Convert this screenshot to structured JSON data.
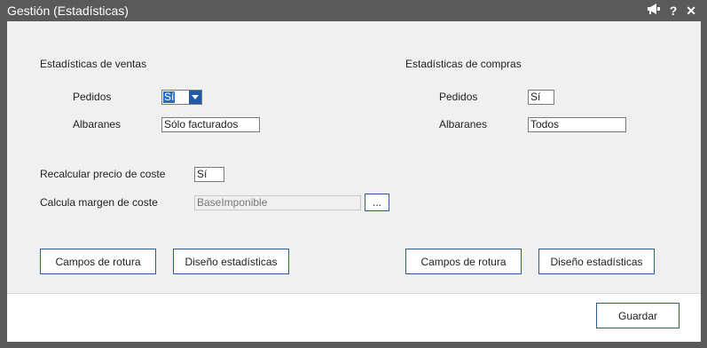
{
  "window": {
    "title": "Gestión (Estadísticas)"
  },
  "title_icons": [
    "megaphone-icon",
    "help-icon",
    "close-icon"
  ],
  "title_glyphs": {
    "help": "?",
    "close": "✕"
  },
  "sales": {
    "heading": "Estadísticas de ventas",
    "pedidos_label": "Pedidos",
    "pedidos_value": "Sí",
    "albaranes_label": "Albaranes",
    "albaranes_value": "Sólo facturados"
  },
  "purchases": {
    "heading": "Estadísticas de compras",
    "pedidos_label": "Pedidos",
    "pedidos_value": "Sí",
    "albaranes_label": "Albaranes",
    "albaranes_value": "Todos"
  },
  "cost": {
    "recalc_label": "Recalcular precio de coste",
    "recalc_value": "Sí",
    "margin_label": "Calcula margen de coste",
    "margin_value": "BaseImponible",
    "ellipsis": "..."
  },
  "buttons": {
    "sales_rotura": "Campos de rotura",
    "sales_diseno": "Diseño estadísticas",
    "purchases_rotura": "Campos de rotura",
    "purchases_diseno": "Diseño estadísticas",
    "guardar": "Guardar"
  },
  "colors": {
    "titlebar": "#5a5a5a",
    "accent": "#2a6cc4",
    "button_border": "#2a5a9a"
  }
}
